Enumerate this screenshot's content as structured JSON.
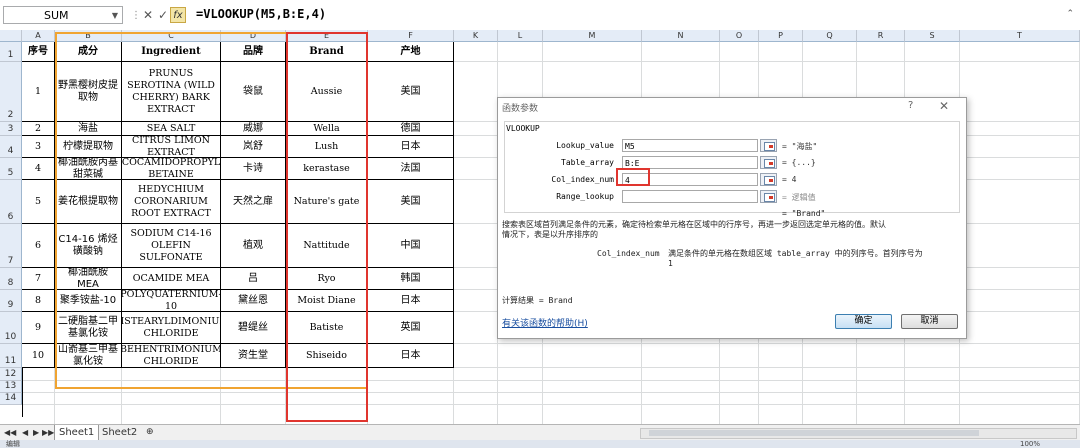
{
  "formula_bar": {
    "name_box": "SUM",
    "fx_label": "fx",
    "formula": "=VLOOKUP(M5,B:E,4)"
  },
  "columns": [
    "A",
    "B",
    "C",
    "D",
    "E",
    "F",
    "K",
    "L",
    "M",
    "N",
    "O",
    "P",
    "Q",
    "R",
    "S",
    "T"
  ],
  "rows": [
    "1",
    "2",
    "3",
    "4",
    "5",
    "6",
    "7",
    "8",
    "9",
    "10",
    "11",
    "12",
    "13",
    "14"
  ],
  "table": {
    "headers": [
      "序号",
      "成分",
      "Ingredient",
      "品牌",
      "Brand",
      "产地"
    ],
    "rows": [
      [
        "1",
        "野黑樱树皮提取物",
        "PRUNUS SEROTINA (WILD CHERRY) BARK EXTRACT",
        "袋鼠",
        "Aussie",
        "美国"
      ],
      [
        "2",
        "海盐",
        "SEA SALT",
        "威娜",
        "Wella",
        "德国"
      ],
      [
        "3",
        "柠檬提取物",
        "CITRUS LIMON EXTRACT",
        "岚舒",
        "Lush",
        "日本"
      ],
      [
        "4",
        "椰油酰胺丙基甜菜碱",
        "COCAMIDOPROPYL BETAINE",
        "卡诗",
        "kerastase",
        "法国"
      ],
      [
        "5",
        "姜花根提取物",
        "HEDYCHIUM CORONARIUM ROOT EXTRACT",
        "天然之扉",
        "Nature's gate",
        "美国"
      ],
      [
        "6",
        "C14-16 烯烃磺酸钠",
        "SODIUM C14-16 OLEFIN SULFONATE",
        "植观",
        "Nattitude",
        "中国"
      ],
      [
        "7",
        "椰油酰胺 MEA",
        "OCAMIDE MEA",
        "吕",
        "Ryo",
        "韩国"
      ],
      [
        "8",
        "聚季铵盐-10",
        "POLYQUATERNIUM-10",
        "黛丝恩",
        "Moist Diane",
        "日本"
      ],
      [
        "9",
        "二硬脂基二甲基氯化铵",
        "DISTEARYLDIMONIUM CHLORIDE",
        "碧缇丝",
        "Batiste",
        "英国"
      ],
      [
        "10",
        "山嵛基三甲基氯化铵",
        "BEHENTRIMONIUM CHLORIDE",
        "资生堂",
        "Shiseido",
        "日本"
      ]
    ]
  },
  "dialog": {
    "title": "函数参数",
    "help_glyph": "?",
    "close_glyph": "✕",
    "function_name": "VLOOKUP",
    "args": [
      {
        "label": "Lookup_value",
        "value": "M5",
        "result": "= \"海盐\""
      },
      {
        "label": "Table_array",
        "value": "B:E",
        "result": "= {...}"
      },
      {
        "label": "Col_index_num",
        "value": "4",
        "result": "= 4"
      },
      {
        "label": "Range_lookup",
        "value": "",
        "result": "= 逻辑值"
      }
    ],
    "overall_result": "= \"Brand\"",
    "description_line1": "搜索表区域首列满足条件的元素，确定待检索单元格在区域中的行序号，再进一步返回选定单元格的值。默认",
    "description_line2": "情况下，表是以升序排序的",
    "arg_help_name": "Col_index_num",
    "arg_help_line1": "满足条件的单元格在数组区域 table_array 中的列序号。首列序号为",
    "arg_help_line2": "1",
    "calc_result": "计算结果 = Brand",
    "help_link": "有关该函数的帮助(H)",
    "ok_label": "确定",
    "cancel_label": "取消"
  },
  "sheets": {
    "tabs": [
      "Sheet1",
      "Sheet2"
    ]
  },
  "status": {
    "mode": "编辑",
    "zoom": "100%"
  }
}
